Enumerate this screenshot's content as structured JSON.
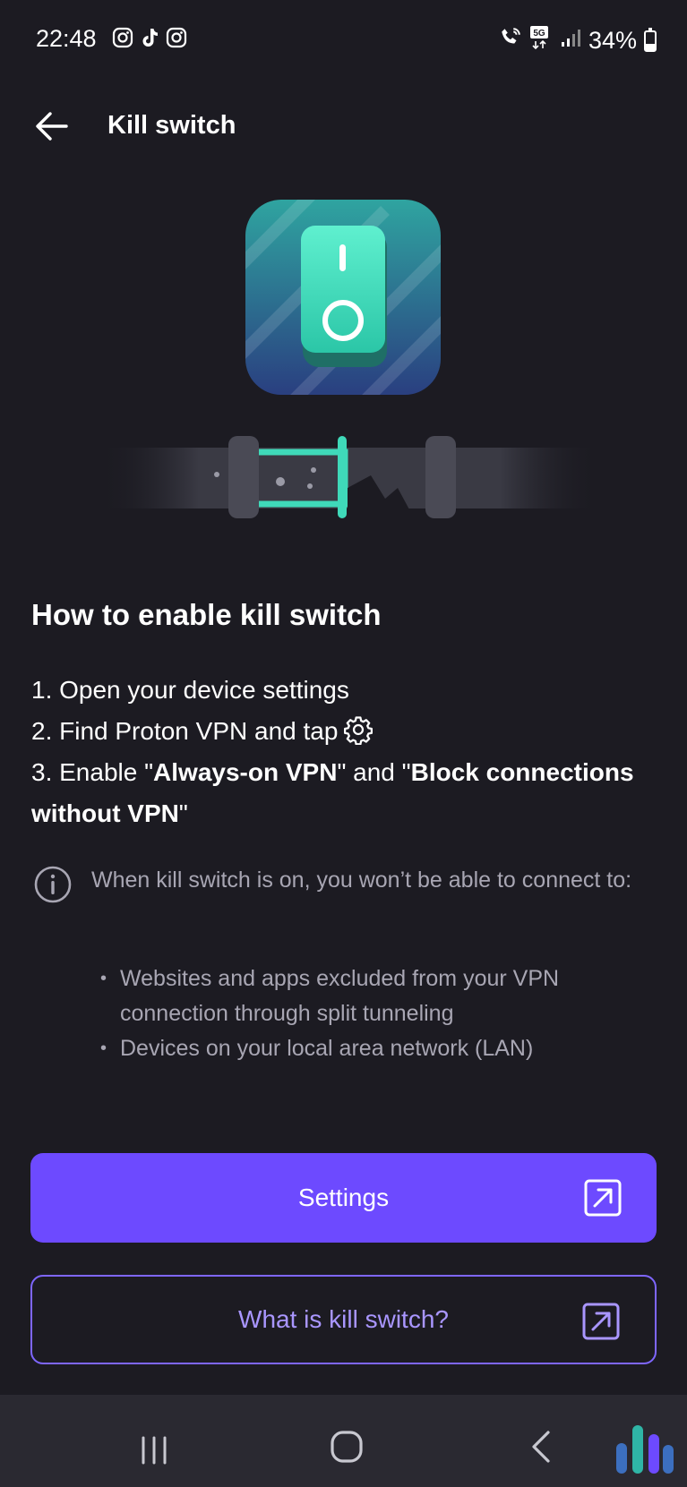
{
  "status_bar": {
    "time": "22:48",
    "battery": "34%",
    "network": "5G"
  },
  "header": {
    "title": "Kill switch"
  },
  "main": {
    "heading": "How to enable kill switch",
    "steps": {
      "step1": "1. Open your device settings",
      "step2": "2. Find Proton VPN and tap",
      "step3_prefix": "3. Enable \"",
      "step3_bold1": "Always-on VPN",
      "step3_mid": "\" and \"",
      "step3_bold2": "Block connections without VPN",
      "step3_suffix": "\""
    },
    "info": {
      "text": "When kill switch is on, you won’t be able to connect to:",
      "bullets": [
        "Websites and apps excluded from your VPN connection through split tunneling",
        "Devices on your local area network (LAN)"
      ]
    }
  },
  "buttons": {
    "settings_label": "Settings",
    "what_is_label": "What is kill switch?"
  },
  "colors": {
    "background": "#1c1b22",
    "primary": "#6d4aff",
    "accent_teal": "#3fd9b9",
    "secondary_text": "#a8a6b3",
    "outline_text": "#a996ff"
  },
  "icons": [
    "back-arrow-icon",
    "gear-icon",
    "info-icon",
    "external-link-icon",
    "kill-switch-illustration",
    "recent-apps-icon",
    "home-icon",
    "nav-back-icon"
  ]
}
